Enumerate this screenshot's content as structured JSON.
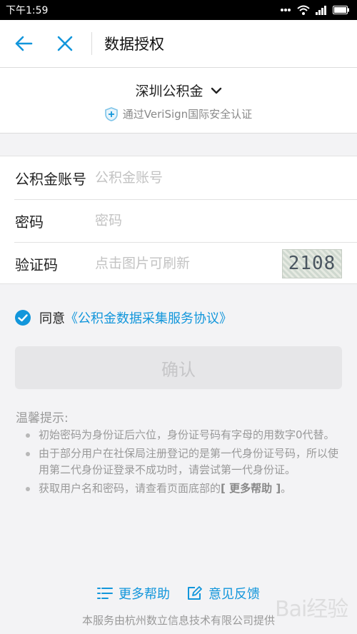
{
  "status_bar": {
    "time": "下午1:59",
    "icons": [
      "signal-dots-icon",
      "wifi-icon",
      "cellular-icon",
      "battery-icon"
    ]
  },
  "nav": {
    "title": "数据授权",
    "back_icon": "arrow-left-icon",
    "close_icon": "close-icon"
  },
  "provider": {
    "name": "深圳公积金",
    "secure_text": "通过VeriSign国际安全认证"
  },
  "form": {
    "account": {
      "label": "公积金账号",
      "placeholder": "公积金账号",
      "value": ""
    },
    "password": {
      "label": "密码",
      "placeholder": "密码",
      "value": ""
    },
    "captcha": {
      "label": "验证码",
      "placeholder": "点击图片可刷新",
      "value": "",
      "image_text": "2108"
    }
  },
  "agreement": {
    "prefix": "同意",
    "link": "《公积金数据采集服务协议》",
    "checked": true
  },
  "confirm_label": "确认",
  "tips": {
    "title": "温馨提示:",
    "items": [
      {
        "text": "初始密码为身份证后六位，身份证号码有字母的用数字0代替。"
      },
      {
        "text": "由于部分用户在社保局注册登记的是第一代身份证号码，所以使用第二代身份证登录不成功时，请尝试第一代身份证。"
      },
      {
        "text": "获取用户名和密码，请查看页面底部的",
        "strong": "[ 更多帮助 ]",
        "suffix": "。"
      }
    ]
  },
  "footer": {
    "help_label": "更多帮助",
    "feedback_label": "意见反馈",
    "provider_text": "本服务由杭州数立信息技术有限公司提供"
  },
  "watermark_text": "Bai经验",
  "colors": {
    "accent": "#1296db",
    "muted": "#999999"
  }
}
